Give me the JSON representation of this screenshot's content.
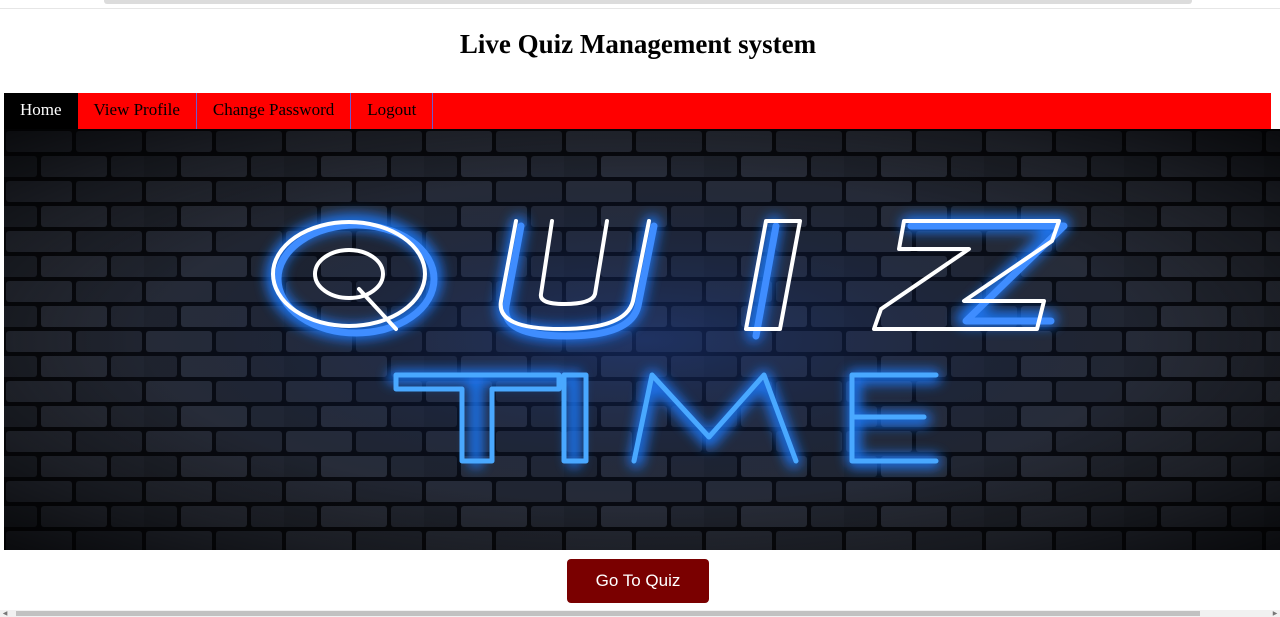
{
  "page": {
    "title": "Live Quiz Management system"
  },
  "nav": {
    "items": [
      {
        "label": "Home",
        "active": true
      },
      {
        "label": "View Profile",
        "active": false
      },
      {
        "label": "Change Password",
        "active": false
      },
      {
        "label": "Logout",
        "active": false
      }
    ],
    "bar_color": "#ff0000",
    "active_color": "#000000"
  },
  "banner": {
    "line1": "QUIZ",
    "line2": "TIME",
    "neon_white": "#ffffff",
    "neon_blue": "#1e7bff"
  },
  "actions": {
    "go_to_quiz": "Go To Quiz",
    "button_color": "#7a0000"
  }
}
